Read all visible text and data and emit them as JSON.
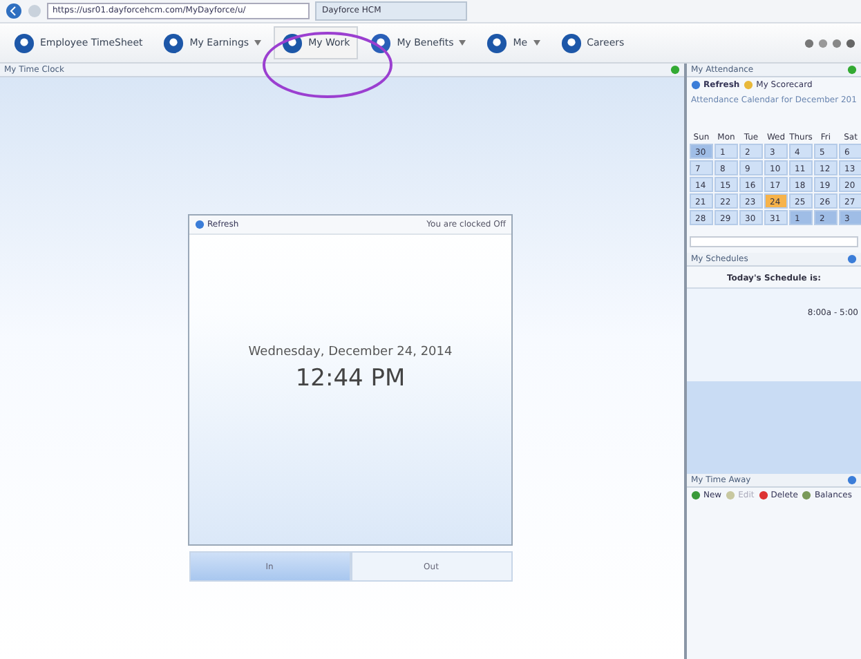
{
  "browser": {
    "url": "https://usr01.dayforcehcm.com/MyDayforce/u/",
    "tab": "Dayforce HCM"
  },
  "nav": [
    {
      "label": "Employee TimeSheet",
      "selected": false,
      "dropdown": false
    },
    {
      "label": "My Earnings",
      "selected": false,
      "dropdown": true
    },
    {
      "label": "My Work",
      "selected": true,
      "dropdown": false
    },
    {
      "label": "My Benefits",
      "selected": false,
      "dropdown": true
    },
    {
      "label": "Me",
      "selected": false,
      "dropdown": true
    },
    {
      "label": "Careers",
      "selected": false,
      "dropdown": false
    }
  ],
  "time_clock": {
    "title": "My Time Clock",
    "refresh": "Refresh",
    "status": "You are clocked Off",
    "date": "Wednesday, December 24, 2014",
    "time": "12:44 PM",
    "buttons": [
      {
        "label": "In",
        "selected": true
      },
      {
        "label": "Out",
        "selected": false
      }
    ]
  },
  "attendance": {
    "title": "My Attendance",
    "toolbar": [
      "Refresh",
      "My Scorecard"
    ],
    "caption": "Attendance Calendar for December 201",
    "weekdays": [
      "Sun",
      "Mon",
      "Tue",
      "Wed",
      "Thurs",
      "Fri",
      "Sat"
    ],
    "days": [
      {
        "label": "30",
        "kind": "other"
      },
      {
        "label": "1",
        "kind": "day"
      },
      {
        "label": "2",
        "kind": "day"
      },
      {
        "label": "3",
        "kind": "day"
      },
      {
        "label": "4",
        "kind": "day"
      },
      {
        "label": "5",
        "kind": "day"
      },
      {
        "label": "6",
        "kind": "day"
      },
      {
        "label": "7",
        "kind": "day"
      },
      {
        "label": "8",
        "kind": "day"
      },
      {
        "label": "9",
        "kind": "day"
      },
      {
        "label": "10",
        "kind": "day"
      },
      {
        "label": "11",
        "kind": "day"
      },
      {
        "label": "12",
        "kind": "day"
      },
      {
        "label": "13",
        "kind": "day"
      },
      {
        "label": "14",
        "kind": "day"
      },
      {
        "label": "15",
        "kind": "day"
      },
      {
        "label": "16",
        "kind": "day"
      },
      {
        "label": "17",
        "kind": "day"
      },
      {
        "label": "18",
        "kind": "day"
      },
      {
        "label": "19",
        "kind": "day"
      },
      {
        "label": "20",
        "kind": "day"
      },
      {
        "label": "21",
        "kind": "day"
      },
      {
        "label": "22",
        "kind": "day"
      },
      {
        "label": "23",
        "kind": "day"
      },
      {
        "label": "24",
        "kind": "today"
      },
      {
        "label": "25",
        "kind": "day"
      },
      {
        "label": "26",
        "kind": "day"
      },
      {
        "label": "27",
        "kind": "day"
      },
      {
        "label": "28",
        "kind": "day"
      },
      {
        "label": "29",
        "kind": "day"
      },
      {
        "label": "30",
        "kind": "day"
      },
      {
        "label": "31",
        "kind": "day"
      },
      {
        "label": "1",
        "kind": "other"
      },
      {
        "label": "2",
        "kind": "other"
      },
      {
        "label": "3",
        "kind": "other"
      }
    ]
  },
  "schedules": {
    "title": "My Schedules",
    "heading": "Today's Schedule is:",
    "shift": "8:00a - 5:00"
  },
  "time_away": {
    "title": "My Time Away",
    "toolbar": [
      {
        "label": "New",
        "disabled": false
      },
      {
        "label": "Edit",
        "disabled": true
      },
      {
        "label": "Delete",
        "disabled": false
      },
      {
        "label": "Balances",
        "disabled": false
      }
    ]
  }
}
